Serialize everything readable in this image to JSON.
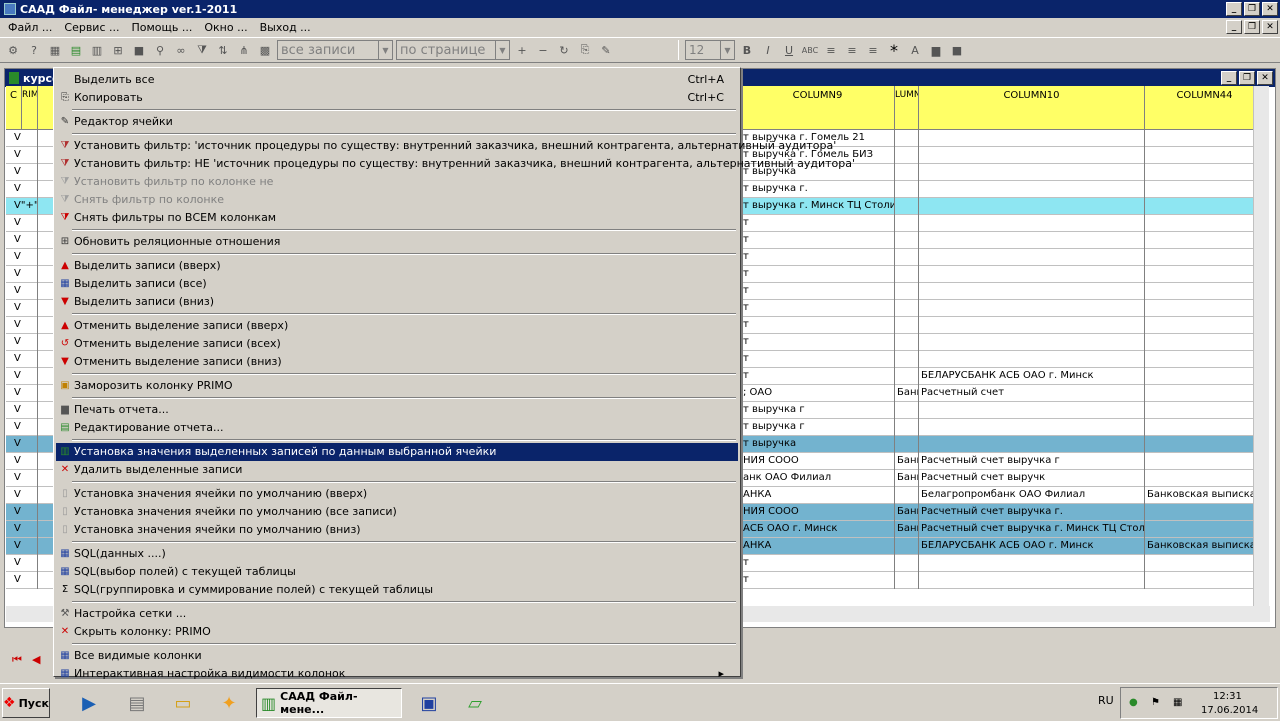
{
  "app": {
    "title": "САAД Файл- менеджер ver.1-2011"
  },
  "menubar": [
    "Файл ...",
    "Сервис ...",
    "Помощь ...",
    "Окно ...",
    "Выход ..."
  ],
  "toolbar": {
    "records_select": "все записи",
    "page_select": "по странице",
    "font_size": "12"
  },
  "child": {
    "title": "курсо"
  },
  "grid": {
    "headers": [
      {
        "label": "С",
        "id": "h-c"
      },
      {
        "label": "RIM",
        "id": "h-rim"
      },
      {
        "label": "COLUMN9",
        "id": "h-col9"
      },
      {
        "label": "LUMN",
        "id": "h-lumn"
      },
      {
        "label": "COLUMN10",
        "id": "h-col10"
      },
      {
        "label": "COLUMN44",
        "id": "h-col44"
      }
    ],
    "rows": [
      {
        "check": "V",
        "col9": "т выручка г. Гомель 21",
        "lumn": "",
        "col10": "",
        "col44": "",
        "style": ""
      },
      {
        "check": "V",
        "col9": "т выручка г. Гомель БИЗ",
        "lumn": "",
        "col10": "",
        "col44": "",
        "style": ""
      },
      {
        "check": "V",
        "col9": "т выручка",
        "lumn": "",
        "col10": "",
        "col44": "",
        "style": ""
      },
      {
        "check": "V",
        "col9": "т выручка г.",
        "lumn": "",
        "col10": "",
        "col44": "",
        "style": ""
      },
      {
        "check": "V\"+\"",
        "col9": "т выручка г. Минск ТЦ Столица",
        "lumn": "",
        "col10": "",
        "col44": "",
        "style": "cy"
      },
      {
        "check": "V",
        "col9": "т",
        "lumn": "",
        "col10": "",
        "col44": "",
        "style": ""
      },
      {
        "check": "V",
        "col9": "т",
        "lumn": "",
        "col10": "",
        "col44": "",
        "style": ""
      },
      {
        "check": "V",
        "col9": "т",
        "lumn": "",
        "col10": "",
        "col44": "",
        "style": ""
      },
      {
        "check": "V",
        "col9": "т",
        "lumn": "",
        "col10": "",
        "col44": "",
        "style": ""
      },
      {
        "check": "V",
        "col9": "т",
        "lumn": "",
        "col10": "",
        "col44": "",
        "style": ""
      },
      {
        "check": "V",
        "col9": "т",
        "lumn": "",
        "col10": "",
        "col44": "",
        "style": ""
      },
      {
        "check": "V",
        "col9": "т",
        "lumn": "",
        "col10": "",
        "col44": "",
        "style": ""
      },
      {
        "check": "V",
        "col9": "т",
        "lumn": "",
        "col10": "",
        "col44": "",
        "style": ""
      },
      {
        "check": "V",
        "col9": "т",
        "lumn": "",
        "col10": "",
        "col44": "",
        "style": ""
      },
      {
        "check": "V",
        "col9": "т",
        "lumn": "",
        "col10": "БЕЛАРУСБАНК АСБ ОАО г. Минск",
        "col44": "",
        "style": ""
      },
      {
        "check": "V",
        "col9": "; ОАО",
        "lumn": "Банк",
        "col10": "Расчетный счет",
        "col44": "",
        "style": ""
      },
      {
        "check": "V",
        "col9": "т выручка г",
        "lumn": "",
        "col10": "",
        "col44": "",
        "style": ""
      },
      {
        "check": "V",
        "col9": "т выручка г",
        "lumn": "",
        "col10": "",
        "col44": "",
        "style": ""
      },
      {
        "check": "V",
        "col9": "т выручка",
        "lumn": "",
        "col10": "",
        "col44": "",
        "style": "bl"
      },
      {
        "check": "V",
        "col9": "НИЯ СООО",
        "lumn": "Банк",
        "col10": "Расчетный счет выручка г",
        "col44": "",
        "style": ""
      },
      {
        "check": "V",
        "col9": "анк ОАО Филиал",
        "lumn": "Банк",
        "col10": "Расчетный счет выручк",
        "col44": "",
        "style": ""
      },
      {
        "check": "V",
        "col9": "АНКА",
        "lumn": "",
        "col10": "Белагропромбанк ОАО Филиал",
        "col44": "Банковская выписка (о",
        "style": ""
      },
      {
        "check": "V",
        "col9": "НИЯ СООО",
        "lumn": "Банк",
        "col10": "Расчетный счет выручка г.",
        "col44": "",
        "style": "bl"
      },
      {
        "check": "V",
        "col9": "АСБ ОАО г. Минск",
        "lumn": "Банк",
        "col10": "Расчетный счет выручка г. Минск ТЦ Столица",
        "col44": "",
        "style": "bl"
      },
      {
        "check": "V",
        "col9": "АНКА",
        "lumn": "",
        "col10": "БЕЛАРУСБАНК АСБ ОАО г. Минск",
        "col44": "Банковская выписка (о",
        "style": "bl"
      },
      {
        "check": "V",
        "col9": "т",
        "lumn": "",
        "col10": "",
        "col44": "",
        "style": ""
      },
      {
        "check": "V",
        "col9": "т",
        "lumn": "",
        "col10": "",
        "col44": "",
        "style": ""
      }
    ]
  },
  "context_menu": [
    {
      "label": "Выделить все",
      "shortcut": "Ctrl+A",
      "icon": "none",
      "state": ""
    },
    {
      "label": "Копировать",
      "shortcut": "Ctrl+C",
      "icon": "copy-icon",
      "state": ""
    },
    {
      "sep": true
    },
    {
      "label": "Редактор ячейки",
      "shortcut": "",
      "icon": "edit-icon",
      "state": ""
    },
    {
      "sep": true
    },
    {
      "label": "Установить фильтр: 'источник процедуры по существу: внутренний заказчика, внешний контрагента, альтернативный аудитора'",
      "shortcut": "",
      "icon": "filter-icon",
      "state": ""
    },
    {
      "label": "Установить фильтр: НЕ 'источник процедуры по существу: внутренний заказчика, внешний контрагента, альтернативный аудитора'",
      "shortcut": "",
      "icon": "filter-icon",
      "state": ""
    },
    {
      "label": "Установить фильтр по колонке не",
      "shortcut": "",
      "icon": "filter-icon",
      "state": "dis"
    },
    {
      "label": "Снять фильтр по колонке",
      "shortcut": "",
      "icon": "filter-icon",
      "state": "dis"
    },
    {
      "label": "Снять фильтры по ВСЕМ колонкам",
      "shortcut": "",
      "icon": "filter-remove-icon",
      "state": ""
    },
    {
      "sep": true
    },
    {
      "label": "Обновить реляционные отношения",
      "shortcut": "",
      "icon": "relations-icon",
      "state": ""
    },
    {
      "sep": true
    },
    {
      "label": "Выделить записи (вверх)",
      "shortcut": "",
      "icon": "arrow-up-icon",
      "state": ""
    },
    {
      "label": "Выделить записи (все)",
      "shortcut": "",
      "icon": "grid-icon",
      "state": ""
    },
    {
      "label": "Выделить записи (вниз)",
      "shortcut": "",
      "icon": "arrow-down-icon",
      "state": ""
    },
    {
      "sep": true
    },
    {
      "label": "Отменить выделение записи (вверх)",
      "shortcut": "",
      "icon": "arrow-up-icon",
      "state": ""
    },
    {
      "label": "Отменить выделение записи (всех)",
      "shortcut": "",
      "icon": "undo-icon",
      "state": ""
    },
    {
      "label": "Отменить выделение записи (вниз)",
      "shortcut": "",
      "icon": "arrow-down-icon",
      "state": ""
    },
    {
      "sep": true
    },
    {
      "label": "Заморозить колонку PRIMO",
      "shortcut": "",
      "icon": "lock-icon",
      "state": ""
    },
    {
      "sep": true
    },
    {
      "label": "Печать отчета...",
      "shortcut": "",
      "icon": "printer-icon",
      "state": ""
    },
    {
      "label": "Редактирование отчета...",
      "shortcut": "",
      "icon": "report-icon",
      "state": ""
    },
    {
      "sep": true
    },
    {
      "label": "Установка значения выделенных записей по данным выбранной ячейки",
      "shortcut": "",
      "icon": "set-value-icon",
      "state": "hl"
    },
    {
      "label": "Удалить выделенные записи",
      "shortcut": "",
      "icon": "delete-icon",
      "state": ""
    },
    {
      "sep": true
    },
    {
      "label": "Установка значения ячейки по умолчанию (вверх)",
      "shortcut": "",
      "icon": "page-icon",
      "state": ""
    },
    {
      "label": "Установка значения ячейки по умолчанию (все записи)",
      "shortcut": "",
      "icon": "page-icon",
      "state": ""
    },
    {
      "label": "Установка значения ячейки по умолчанию (вниз)",
      "shortcut": "",
      "icon": "page-icon",
      "state": ""
    },
    {
      "sep": true
    },
    {
      "label": "SQL(данных ....)",
      "shortcut": "",
      "icon": "sql-icon",
      "state": ""
    },
    {
      "label": "SQL(выбор полей) с текущей таблицы",
      "shortcut": "",
      "icon": "sql-icon",
      "state": ""
    },
    {
      "label": "SQL(группировка и суммирование полей) с текущей таблицы",
      "shortcut": "",
      "icon": "sigma-icon",
      "state": ""
    },
    {
      "sep": true
    },
    {
      "label": "Настройка сетки ...",
      "shortcut": "",
      "icon": "tools-icon",
      "state": ""
    },
    {
      "label": "Скрыть колонку: PRIMO",
      "shortcut": "",
      "icon": "delete-icon",
      "state": ""
    },
    {
      "sep": true
    },
    {
      "label": "Все видимые колонки",
      "shortcut": "",
      "icon": "grid-icon",
      "state": ""
    },
    {
      "label": "Интерактивная настройка видимости колонок",
      "shortcut": "",
      "icon": "grid-icon",
      "state": "sub"
    }
  ],
  "taskbar": {
    "start_label": "Пуск",
    "task_label": "САAД Файл- мене...",
    "lang": "RU",
    "time": "12:31",
    "date": "17.06.2014"
  },
  "colors": {
    "title_bg": "#0a246a",
    "header_yellow": "#ffff66",
    "row_blue": "#73b3cf",
    "row_cyan": "#8ee6f2",
    "highlight": "#0a246a"
  }
}
